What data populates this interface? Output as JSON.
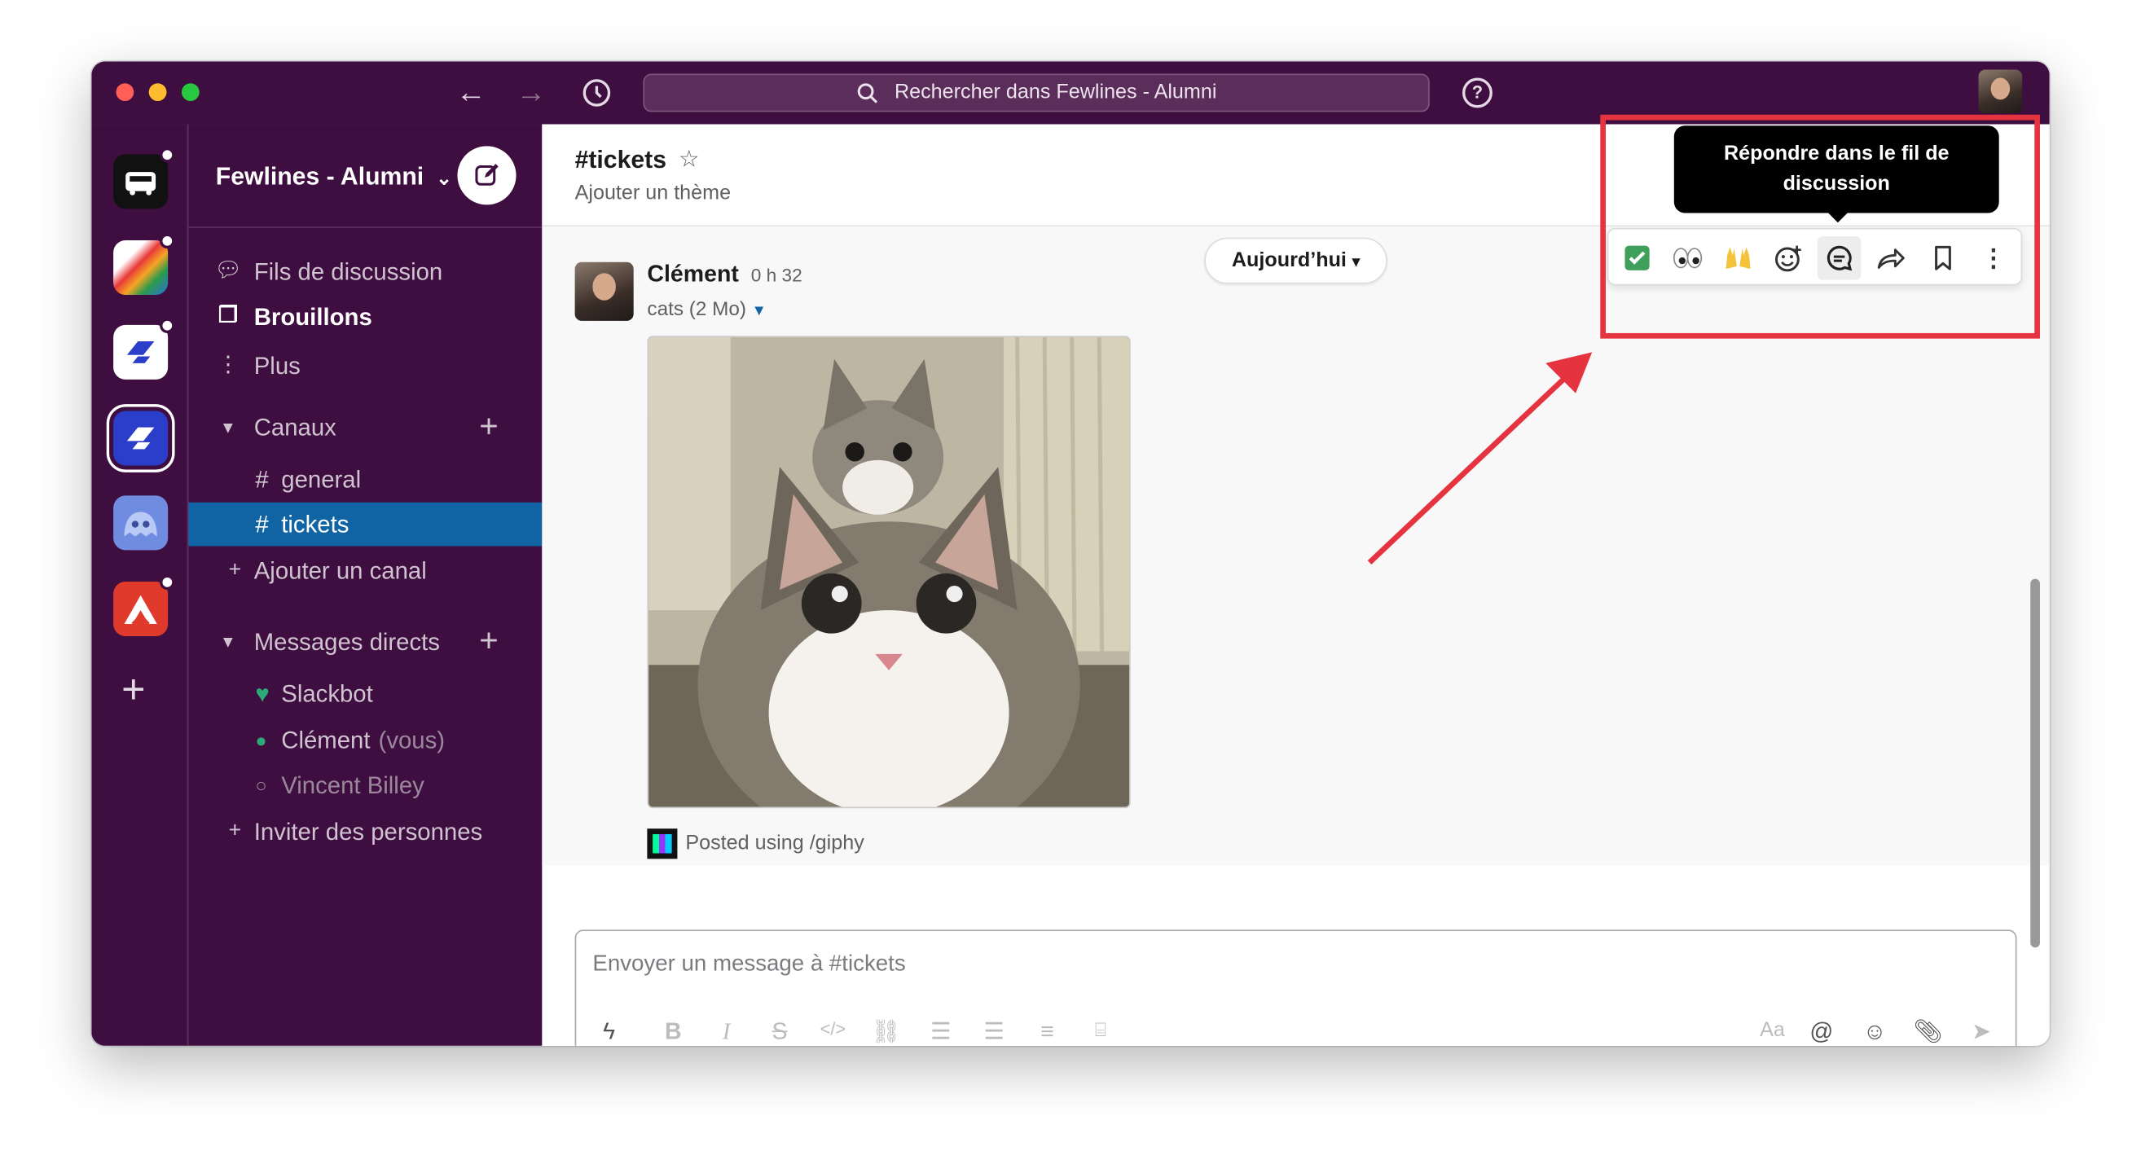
{
  "window": {
    "search_placeholder": "Rechercher dans Fewlines - Alumni",
    "help_label": "?"
  },
  "workspaces": {
    "add_label": "+"
  },
  "sidebar": {
    "team_name": "Fewlines - Alumni",
    "team_chevron": "⌄",
    "nav": [
      {
        "icon": "threads-icon",
        "label": "Fils de discussion"
      },
      {
        "icon": "drafts-icon",
        "label": "Brouillons"
      },
      {
        "icon": "more-icon",
        "label": "Plus"
      }
    ],
    "channels_header": "Canaux",
    "channels": [
      {
        "prefix": "#",
        "label": "general"
      },
      {
        "prefix": "#",
        "label": "tickets",
        "active": true
      }
    ],
    "add_channel": "Ajouter un canal",
    "dm_header": "Messages directs",
    "dms": [
      {
        "label": "Slackbot",
        "suffix": ""
      },
      {
        "label": "Clément",
        "suffix": "(vous)"
      },
      {
        "label": "Vincent Billey",
        "suffix": ""
      }
    ],
    "invite": "Inviter des personnes"
  },
  "channel": {
    "name": "#tickets",
    "topic": "Ajouter un thème",
    "day_divider": "Aujourd’hui"
  },
  "message": {
    "author": "Clément",
    "time": "0 h 32",
    "file_label": "cats (2 Mo)",
    "footer": "Posted using /giphy"
  },
  "composer": {
    "placeholder": "Envoyer un message à #tickets",
    "text_style_label": "Aa"
  },
  "hover_toolbar": {
    "tooltip": "Répondre dans le fil de discussion",
    "actions": [
      "white-check-mark-emoji",
      "eyes-emoji",
      "raised-hands-emoji",
      "add-reaction-icon",
      "reply-in-thread-icon",
      "share-icon",
      "bookmark-icon",
      "more-actions-icon"
    ]
  },
  "colors": {
    "aubergine": "#3f0e40",
    "active_channel": "#1164a3",
    "annotation_red": "#e53340"
  }
}
